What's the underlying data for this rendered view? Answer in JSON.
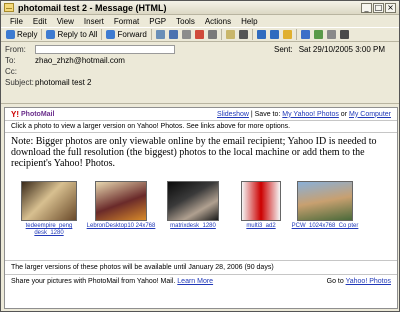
{
  "window": {
    "title": "photomail test 2 - Message (HTML)",
    "controls": [
      "_",
      "□",
      "×"
    ]
  },
  "menu": [
    "File",
    "Edit",
    "View",
    "Insert",
    "Format",
    "PGP",
    "Tools",
    "Actions",
    "Help"
  ],
  "toolbar": {
    "reply": "Reply",
    "reply_all": "Reply to All",
    "forward": "Forward"
  },
  "header": {
    "from_label": "From:",
    "to_label": "To:",
    "to_value": "zhao_zhzh@hotmail.com",
    "cc_label": "Cc:",
    "subject_label": "Subject:",
    "subject_value": "photomail test 2",
    "sent_label": "Sent:",
    "sent_value": "Sat 29/10/2005 3:00 PM"
  },
  "photomail": {
    "logo": "PhotoMail",
    "logo_mark": "Y!",
    "slideshow": "Slideshow",
    "save_to": "| Save to:",
    "my_yahoo_photos": "My Yahoo! Photos",
    "or": "or",
    "my_computer": "My Computer",
    "click_info": "Click a photo to view a larger version on Yahoo! Photos. See links above for more options.",
    "note": "Note: Bigger photos are only viewable online by the email recipient; Yahoo ID is needed to download the full resolution (the biggest) photos to the local machine or add them to the recipient's Yahoo! Photos.",
    "thumbnails": [
      {
        "caption": "tedeempire_peng desk_1280"
      },
      {
        "caption": "LebronDesktop10 24x768"
      },
      {
        "caption": "matrixdesk_1280"
      },
      {
        "caption": "multi3_ad2"
      },
      {
        "caption": "PCW_1024x768_Co pter"
      }
    ],
    "larger_versions": "The larger versions of these photos will be available until January 28, 2006 (90 days)",
    "share_text": "Share your pictures with PhotoMail from Yahoo! Mail.",
    "learn_more": "Learn More",
    "goto": "Go to",
    "yahoo_photos": "Yahoo! Photos"
  }
}
